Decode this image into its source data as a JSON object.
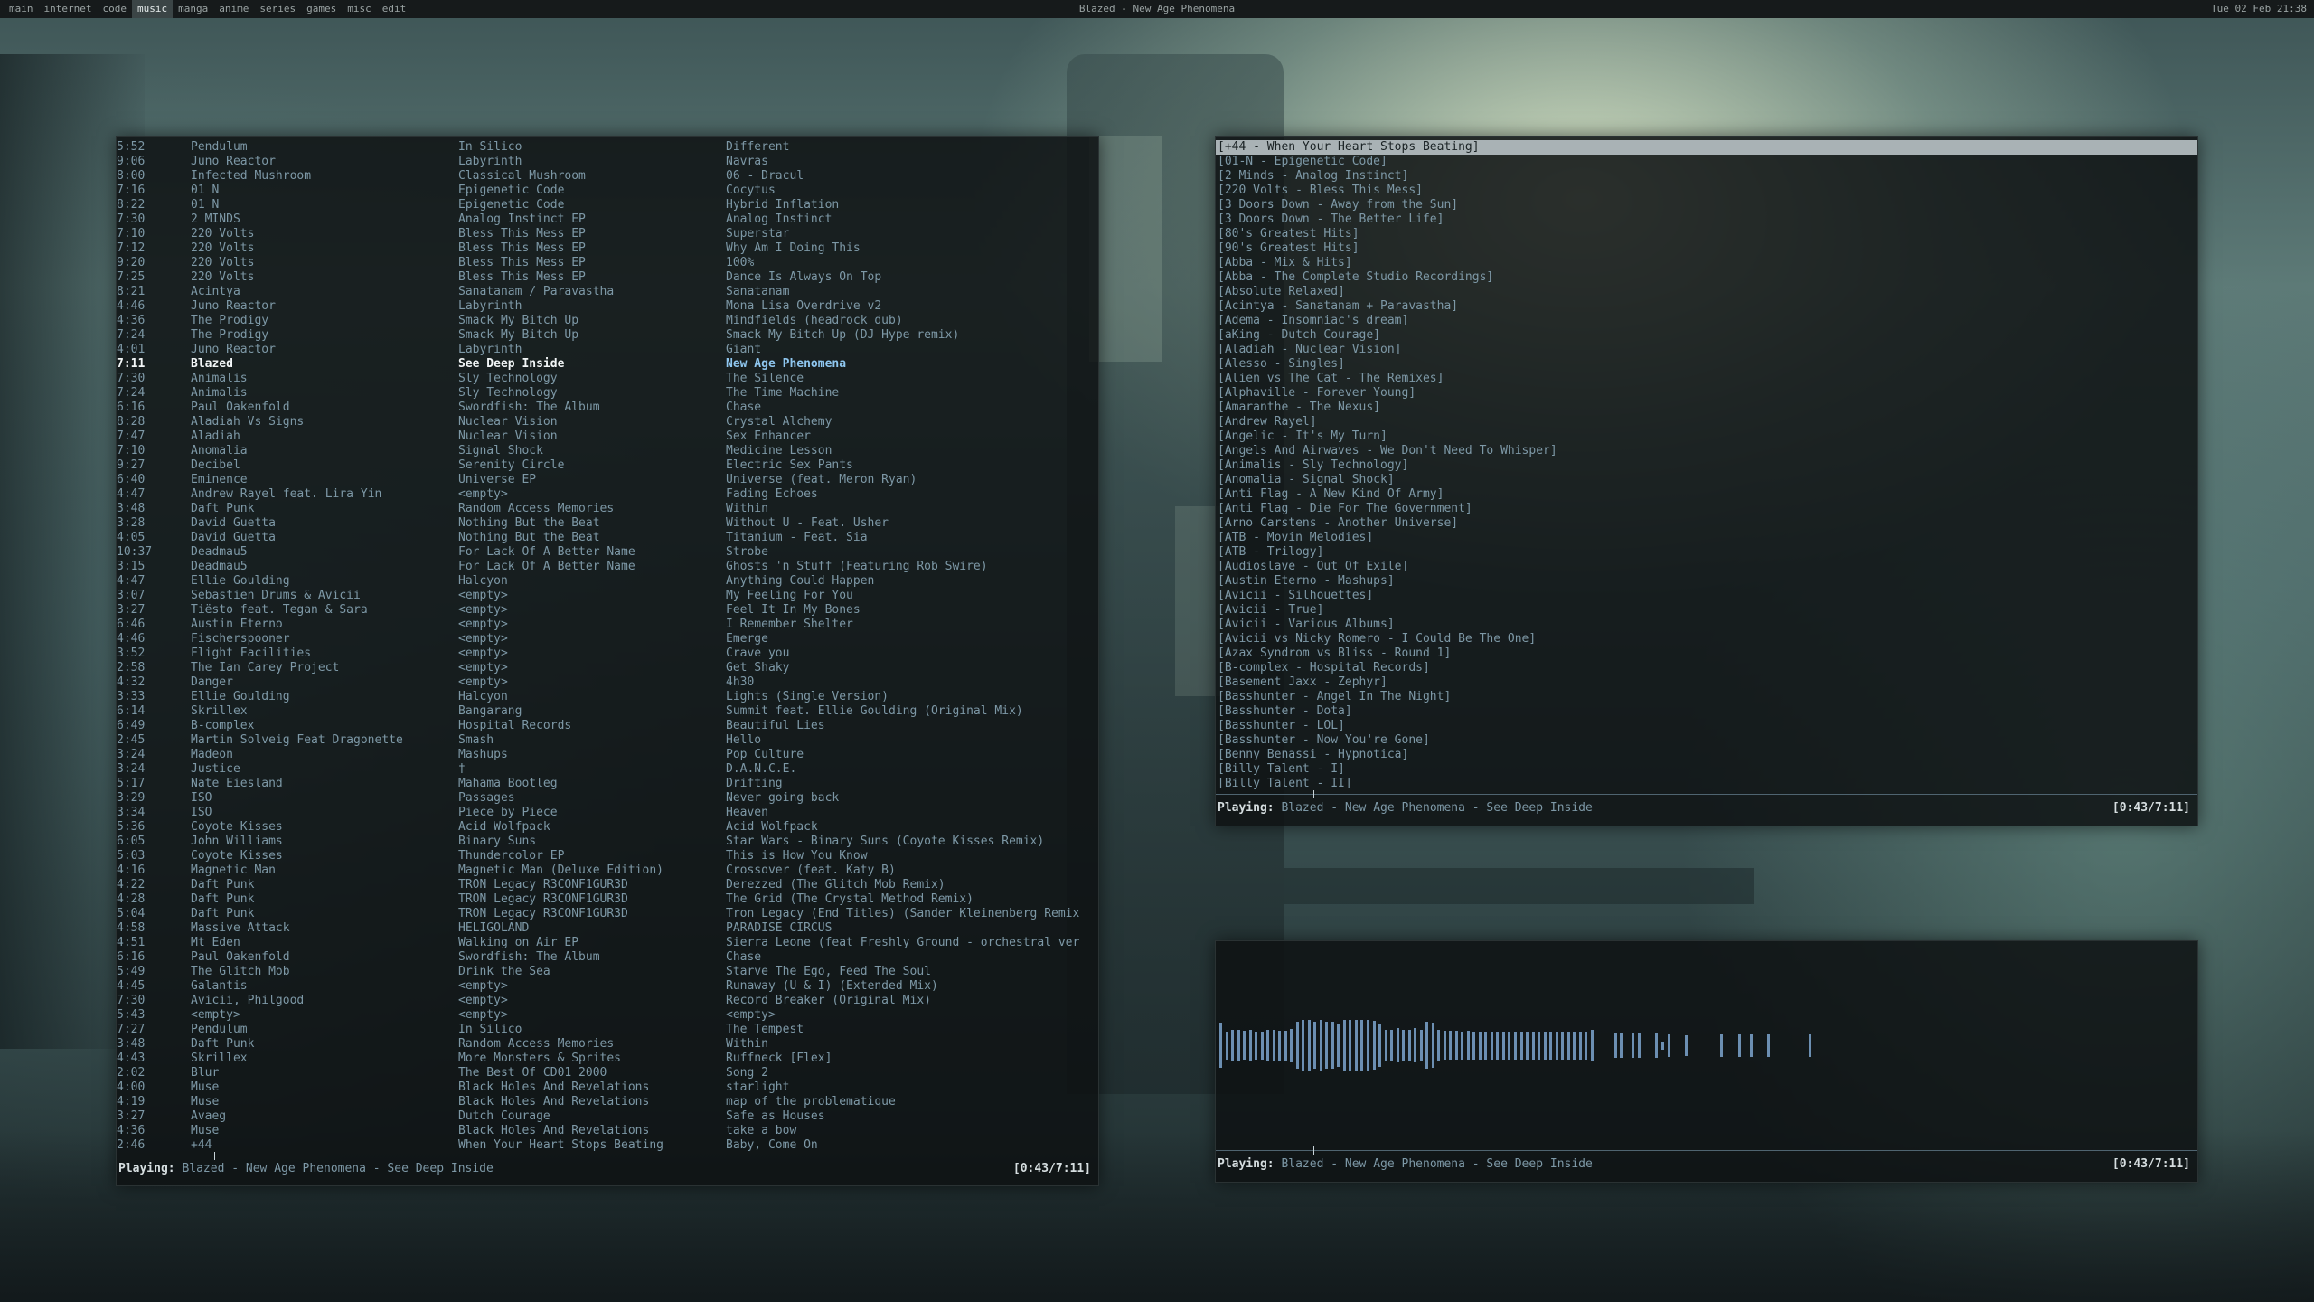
{
  "topbar": {
    "workspaces": [
      "main",
      "internet",
      "code",
      "music",
      "manga",
      "anime",
      "series",
      "games",
      "misc",
      "edit"
    ],
    "active_workspace": "music",
    "window_title": "Blazed - New Age Phenomena",
    "clock": "Tue 02 Feb 21:38"
  },
  "songs": [
    [
      "5:52",
      "Pendulum",
      "In Silico",
      "Different"
    ],
    [
      "9:06",
      "Juno Reactor",
      "Labyrinth",
      "Navras"
    ],
    [
      "8:00",
      "Infected Mushroom",
      "Classical Mushroom",
      "06 - Dracul"
    ],
    [
      "7:16",
      "01 N",
      "Epigenetic Code",
      "Cocytus"
    ],
    [
      "8:22",
      "01 N",
      "Epigenetic Code",
      "Hybrid Inflation"
    ],
    [
      "7:30",
      "2 MINDS",
      "Analog Instinct EP",
      "Analog Instinct"
    ],
    [
      "7:10",
      "220 Volts",
      "Bless This Mess EP",
      "Superstar"
    ],
    [
      "7:12",
      "220 Volts",
      "Bless This Mess EP",
      "Why Am I Doing This"
    ],
    [
      "9:20",
      "220 Volts",
      "Bless This Mess EP",
      "100%"
    ],
    [
      "7:25",
      "220 Volts",
      "Bless This Mess EP",
      "Dance Is Always On Top"
    ],
    [
      "8:21",
      "Acintya",
      "Sanatanam / Paravastha",
      "Sanatanam"
    ],
    [
      "4:46",
      "Juno Reactor",
      "Labyrinth",
      "Mona Lisa Overdrive v2"
    ],
    [
      "4:36",
      "The Prodigy",
      "Smack My Bitch Up",
      "Mindfields (headrock dub)"
    ],
    [
      "7:24",
      "The Prodigy",
      "Smack My Bitch Up",
      "Smack My Bitch Up (DJ Hype remix)"
    ],
    [
      "4:01",
      "Juno Reactor",
      "Labyrinth",
      "Giant"
    ],
    [
      "7:11",
      "Blazed",
      "See Deep Inside",
      "New Age Phenomena"
    ],
    [
      "7:30",
      "Animalis",
      "Sly Technology",
      "The Silence"
    ],
    [
      "7:24",
      "Animalis",
      "Sly Technology",
      "The Time Machine"
    ],
    [
      "6:16",
      "Paul Oakenfold",
      "Swordfish: The Album",
      "Chase"
    ],
    [
      "8:28",
      "Aladiah Vs Signs",
      "Nuclear Vision",
      "Crystal Alchemy"
    ],
    [
      "7:47",
      "Aladiah",
      "Nuclear Vision",
      "Sex Enhancer"
    ],
    [
      "7:10",
      "Anomalia",
      "Signal Shock",
      "Medicine Lesson"
    ],
    [
      "9:27",
      "Decibel",
      "Serenity Circle",
      "Electric Sex Pants"
    ],
    [
      "6:40",
      "Eminence",
      "Universe EP",
      "Universe (feat. Meron Ryan)"
    ],
    [
      "4:47",
      "Andrew Rayel feat. Lira Yin",
      "<empty>",
      "Fading Echoes"
    ],
    [
      "3:48",
      "Daft Punk",
      "Random Access Memories",
      "Within"
    ],
    [
      "3:28",
      "David Guetta",
      "Nothing But the Beat",
      "Without U - Feat. Usher"
    ],
    [
      "4:05",
      "David Guetta",
      "Nothing But the Beat",
      "Titanium - Feat. Sia"
    ],
    [
      "10:37",
      "Deadmau5",
      "For Lack Of A Better Name",
      "Strobe"
    ],
    [
      "3:15",
      "Deadmau5",
      "For Lack Of A Better Name",
      "Ghosts 'n Stuff (Featuring Rob Swire)"
    ],
    [
      "4:47",
      "Ellie Goulding",
      "Halcyon",
      "Anything Could Happen"
    ],
    [
      "3:07",
      "Sebastien Drums & Avicii",
      "<empty>",
      "My Feeling For You"
    ],
    [
      "3:27",
      "Tiësto feat. Tegan & Sara",
      "<empty>",
      "Feel It In My Bones"
    ],
    [
      "6:46",
      "Austin Eterno",
      "<empty>",
      "I Remember Shelter"
    ],
    [
      "4:46",
      "Fischerspooner",
      "<empty>",
      "Emerge"
    ],
    [
      "3:52",
      "Flight Facilities",
      "<empty>",
      "Crave you"
    ],
    [
      "2:58",
      "The Ian Carey Project",
      "<empty>",
      "Get Shaky"
    ],
    [
      "4:32",
      "Danger",
      "<empty>",
      "4h30"
    ],
    [
      "3:33",
      "Ellie Goulding",
      "Halcyon",
      "Lights (Single Version)"
    ],
    [
      "6:14",
      "Skrillex",
      "Bangarang",
      "Summit feat. Ellie Goulding (Original Mix)"
    ],
    [
      "6:49",
      "B-complex",
      "Hospital Records",
      "Beautiful Lies"
    ],
    [
      "2:45",
      "Martin Solveig Feat Dragonette",
      "Smash",
      "Hello"
    ],
    [
      "3:24",
      "Madeon",
      "Mashups",
      "Pop Culture"
    ],
    [
      "3:24",
      "Justice",
      "†",
      "D.A.N.C.E."
    ],
    [
      "5:17",
      "Nate Eiesland",
      "Mahama Bootleg",
      "Drifting"
    ],
    [
      "3:29",
      "ISO",
      "Passages",
      "Never going back"
    ],
    [
      "3:34",
      "ISO",
      "Piece by Piece",
      "Heaven"
    ],
    [
      "5:36",
      "Coyote Kisses",
      "Acid Wolfpack",
      "Acid Wolfpack"
    ],
    [
      "6:05",
      "John Williams",
      "Binary Suns",
      "Star Wars - Binary Suns (Coyote Kisses Remix)"
    ],
    [
      "5:03",
      "Coyote Kisses",
      "Thundercolor EP",
      "This is How You Know"
    ],
    [
      "4:16",
      "Magnetic Man",
      "Magnetic Man (Deluxe Edition)",
      "Crossover (feat. Katy B)"
    ],
    [
      "4:22",
      "Daft Punk",
      "TRON Legacy R3CONF1GUR3D",
      "Derezzed (The Glitch Mob Remix)"
    ],
    [
      "4:28",
      "Daft Punk",
      "TRON Legacy R3CONF1GUR3D",
      "The Grid (The Crystal Method Remix)"
    ],
    [
      "5:04",
      "Daft Punk",
      "TRON Legacy R3CONF1GUR3D",
      "Tron Legacy (End Titles) (Sander Kleinenberg Remix"
    ],
    [
      "4:58",
      "Massive Attack",
      "HELIGOLAND",
      "PARADISE CIRCUS"
    ],
    [
      "4:51",
      "Mt Eden",
      "Walking on Air EP",
      "Sierra Leone (feat Freshly Ground - orchestral ver"
    ],
    [
      "6:16",
      "Paul Oakenfold",
      "Swordfish: The Album",
      "Chase"
    ],
    [
      "5:49",
      "The Glitch Mob",
      "Drink the Sea",
      "Starve The Ego, Feed The Soul"
    ],
    [
      "4:45",
      "Galantis",
      "<empty>",
      "Runaway (U & I) (Extended Mix)"
    ],
    [
      "7:30",
      "Avicii, Philgood",
      "<empty>",
      "Record Breaker (Original Mix)"
    ],
    [
      "5:43",
      "<empty>",
      "<empty>",
      "<empty>"
    ],
    [
      "7:27",
      "Pendulum",
      "In Silico",
      "The Tempest"
    ],
    [
      "3:48",
      "Daft Punk",
      "Random Access Memories",
      "Within"
    ],
    [
      "4:43",
      "Skrillex",
      "More Monsters & Sprites",
      "Ruffneck [Flex]"
    ],
    [
      "2:02",
      "Blur",
      "The Best Of CD01 2000",
      "Song 2"
    ],
    [
      "4:00",
      "Muse",
      "Black Holes And Revelations",
      "starlight"
    ],
    [
      "4:19",
      "Muse",
      "Black Holes And Revelations",
      "map of the problematique"
    ],
    [
      "3:27",
      "Avaeg",
      "Dutch Courage",
      "Safe as Houses"
    ],
    [
      "4:36",
      "Muse",
      "Black Holes And Revelations",
      "take a bow"
    ],
    [
      "2:46",
      "+44",
      "When Your Heart Stops Beating",
      "Baby, Come On"
    ]
  ],
  "current_song_index": 15,
  "playlists": [
    "[+44 - When Your Heart Stops Beating]",
    "[01-N - Epigenetic Code]",
    "[2 Minds - Analog Instinct]",
    "[220 Volts - Bless This Mess]",
    "[3 Doors Down - Away from the Sun]",
    "[3 Doors Down - The Better Life]",
    "[80's Greatest Hits]",
    "[90's Greatest Hits]",
    "[Abba - Mix & Hits]",
    "[Abba - The Complete Studio Recordings]",
    "[Absolute Relaxed]",
    "[Acintya - Sanatanam + Paravastha]",
    "[Adema - Insomniac's dream]",
    "[aKing - Dutch Courage]",
    "[Aladiah - Nuclear Vision]",
    "[Alesso - Singles]",
    "[Alien vs The Cat - The Remixes]",
    "[Alphaville - Forever Young]",
    "[Amaranthe - The Nexus]",
    "[Andrew Rayel]",
    "[Angelic - It's My Turn]",
    "[Angels And Airwaves - We Don't Need To Whisper]",
    "[Animalis - Sly Technology]",
    "[Anomalia - Signal Shock]",
    "[Anti Flag - A New Kind Of Army]",
    "[Anti Flag - Die For The Government]",
    "[Arno Carstens - Another Universe]",
    "[ATB - Movin Melodies]",
    "[ATB - Trilogy]",
    "[Audioslave - Out Of Exile]",
    "[Austin Eterno - Mashups]",
    "[Avicii - Silhouettes]",
    "[Avicii - True]",
    "[Avicii - Various Albums]",
    "[Avicii vs Nicky Romero - I Could Be The One]",
    "[Azax Syndrom vs Bliss - Round 1]",
    "[B-complex - Hospital Records]",
    "[Basement Jaxx - Zephyr]",
    "[Basshunter - Angel In The Night]",
    "[Basshunter - Dota]",
    "[Basshunter - LOL]",
    "[Basshunter - Now You're Gone]",
    "[Benny Benassi - Hypnotica]",
    "[Billy Talent - I]",
    "[Billy Talent - II]"
  ],
  "selected_playlist_index": 0,
  "status": {
    "label": "Playing:",
    "info": "Blazed - New Age Phenomena - See Deep Inside",
    "time": "[0:43/7:11]",
    "progress": 0.0998
  },
  "visualizer": {
    "bar_color": "#6c8fb2",
    "levels": [
      0.55,
      0.35,
      0.38,
      0.38,
      0.36,
      0.38,
      0.34,
      0.35,
      0.38,
      0.38,
      0.37,
      0.37,
      0.41,
      0.58,
      0.63,
      0.63,
      0.58,
      0.63,
      0.58,
      0.58,
      0.52,
      0.63,
      0.63,
      0.63,
      0.63,
      0.63,
      0.6,
      0.52,
      0.38,
      0.38,
      0.42,
      0.38,
      0.38,
      0.42,
      0.38,
      0.58,
      0.55,
      0.38,
      0.36,
      0.36,
      0.36,
      0.34,
      0.36,
      0.34,
      0.34,
      0.34,
      0.34,
      0.34,
      0.34,
      0.34,
      0.34,
      0.34,
      0.34,
      0.34,
      0.34,
      0.34,
      0.34,
      0.34,
      0.34,
      0.34,
      0.34,
      0.34,
      0.34,
      0.38,
      0,
      0,
      0,
      0.3,
      0.3,
      0,
      0.3,
      0.3,
      0,
      0,
      0.3,
      0.1,
      0.28,
      0,
      0,
      0.25,
      0,
      0,
      0,
      0,
      0,
      0.28,
      0,
      0,
      0.28,
      0,
      0.28,
      0,
      0,
      0.28,
      0,
      0,
      0,
      0,
      0,
      0,
      0.28
    ]
  }
}
